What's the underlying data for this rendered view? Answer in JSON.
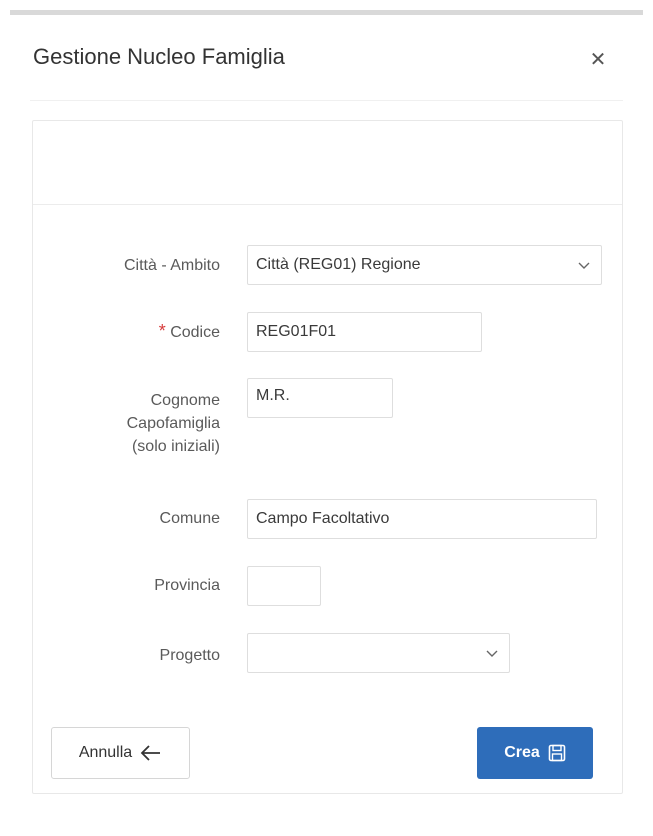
{
  "dialog": {
    "title": "Gestione Nucleo Famiglia",
    "close_icon": "close-icon"
  },
  "form": {
    "citta_ambito": {
      "label": "Città - Ambito",
      "value": "Città (REG01) Regione"
    },
    "codice": {
      "required_marker": "*",
      "label": "Codice",
      "value": "REG01F01"
    },
    "cognome": {
      "label_line1": "Cognome",
      "label_line2": "Capofamiglia",
      "label_line3": "(solo iniziali)",
      "value": "M.R."
    },
    "comune": {
      "label": "Comune",
      "value": "Campo Facoltativo"
    },
    "provincia": {
      "label": "Provincia",
      "value": ""
    },
    "progetto": {
      "label": "Progetto",
      "value": ""
    }
  },
  "buttons": {
    "cancel_label": "Annulla",
    "cancel_icon": "arrow-left-icon",
    "create_label": "Crea",
    "create_icon": "save-icon"
  },
  "colors": {
    "primary": "#2e6dba",
    "required": "#d63a3a"
  }
}
